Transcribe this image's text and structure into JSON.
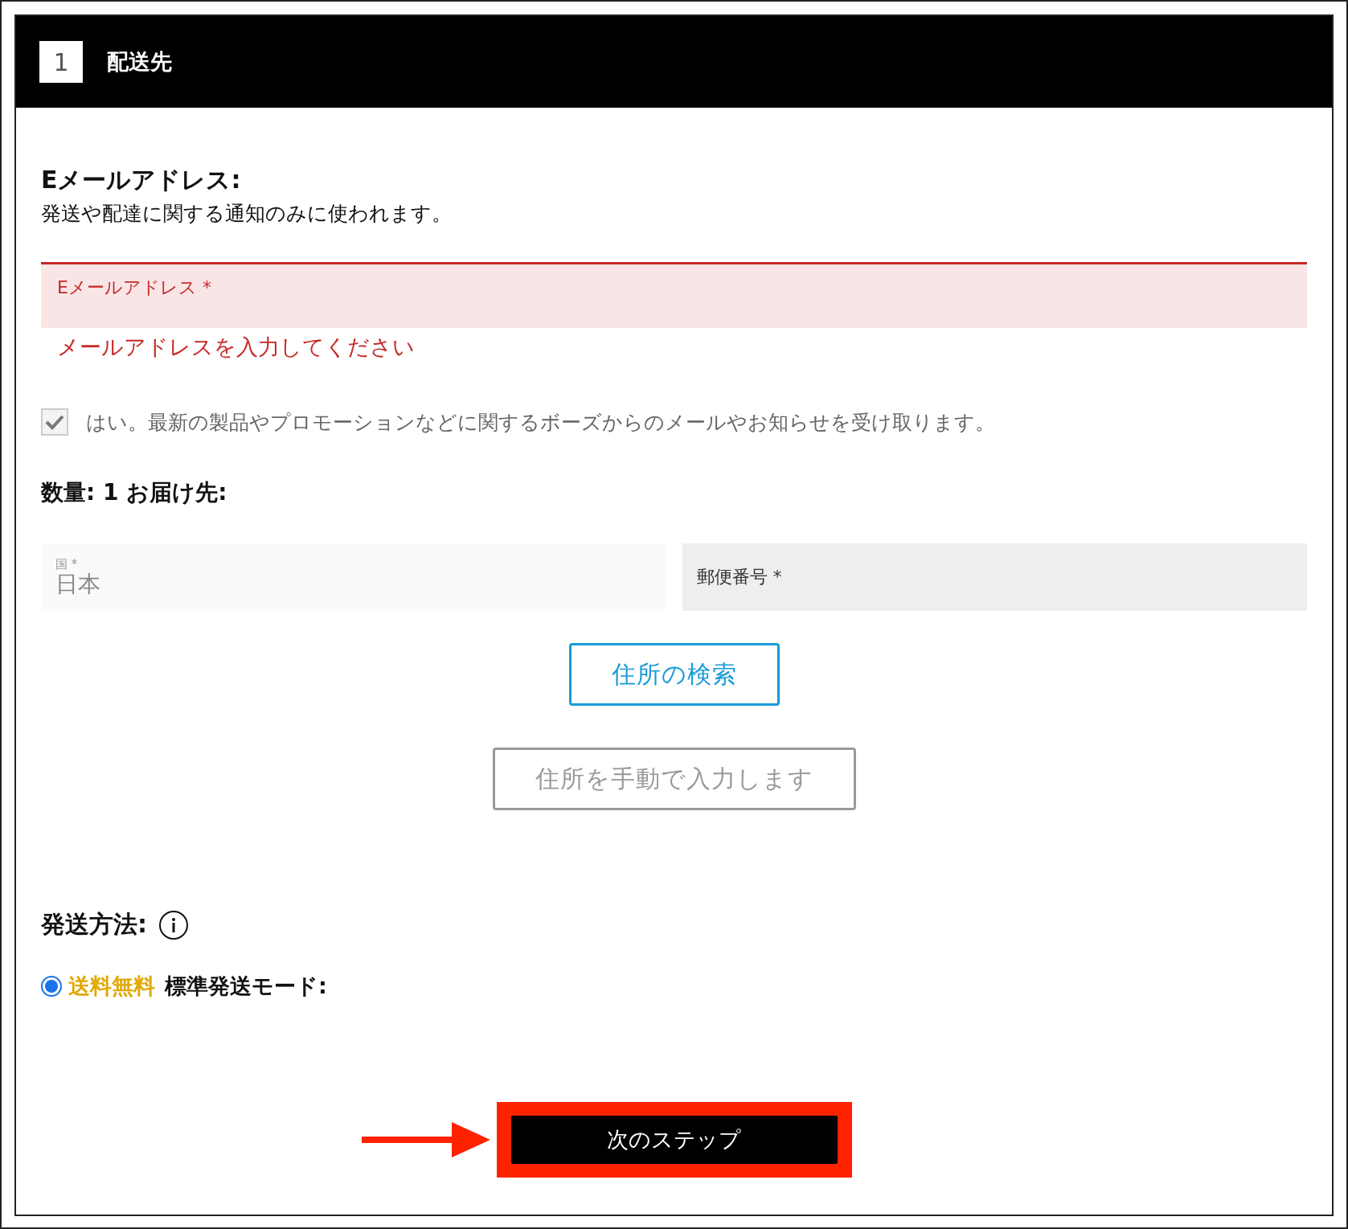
{
  "step": {
    "number": "1",
    "title": "配送先"
  },
  "email_section": {
    "title": "Eメールアドレス:",
    "note": "発送や配達に関する通知のみに使われます。",
    "field": {
      "label": "Eメールアドレス *",
      "error": true
    },
    "error_message": "メールアドレスを入力してください",
    "opt_in": {
      "label": "はい。最新の製品やプロモーションなどに関するボーズからのメールやお知らせを受け取ります。",
      "checked": true
    }
  },
  "address_section": {
    "title": "数量: 1 お届け先:",
    "fields": [
      {
        "label": "国 *",
        "value": "日本",
        "disabled": true
      },
      {
        "label": "郵便番号 *",
        "disabled": false
      }
    ],
    "buttons": [
      {
        "label": "住所の検索",
        "kind": "primary"
      },
      {
        "label": "住所を手動で入力します",
        "kind": "secondary"
      }
    ]
  },
  "shipping_section": {
    "title": "発送方法:",
    "options": [
      {
        "badge": "送料無料",
        "color": "#e0a800",
        "label": "標準発送モード:",
        "selected": true
      }
    ]
  },
  "next_button": {
    "label": "次のステップ",
    "highlighted": true
  }
}
